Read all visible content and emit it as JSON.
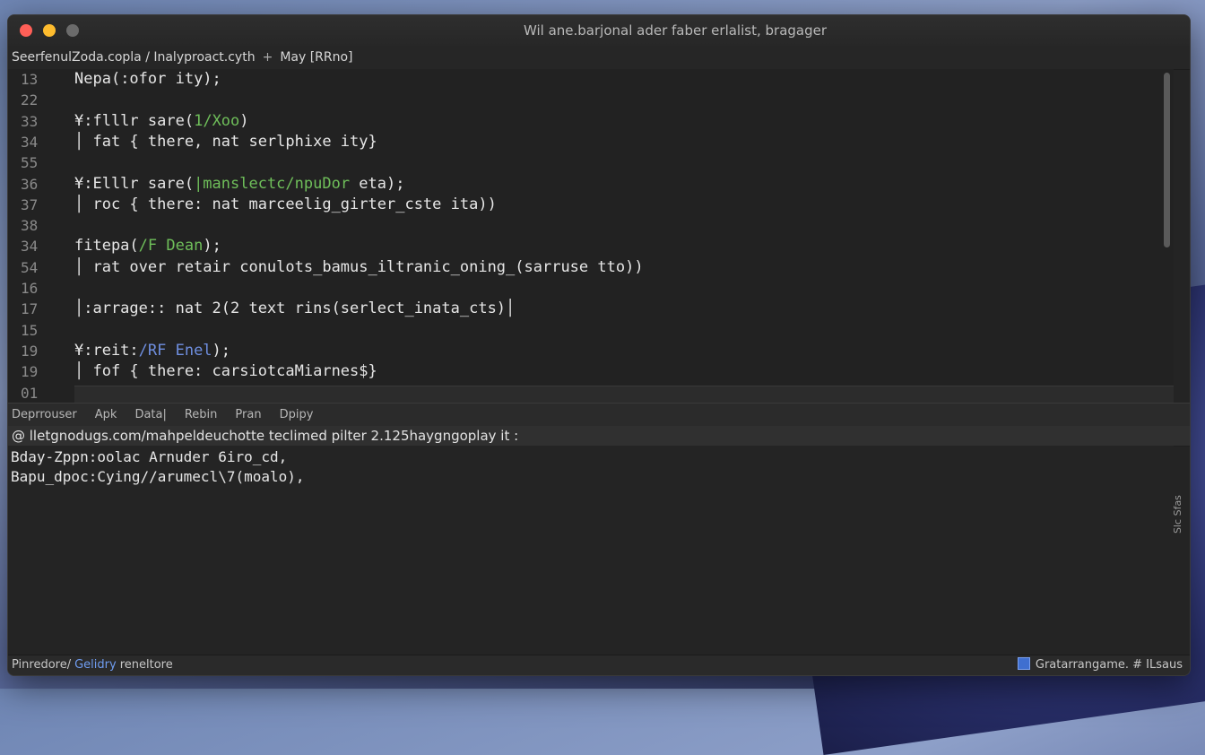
{
  "window": {
    "title": "Wil ane.barjonal ader faber erlalist, bragager"
  },
  "breadcrumb": {
    "path": "Seerfenul​Zoda.copla / Inalyproact.cyth",
    "separator": "+",
    "current": "May [RRno]"
  },
  "editor": {
    "lines": [
      {
        "num": "13",
        "parts": [
          {
            "t": "Nepa‏(:ofor ity);"
          }
        ]
      },
      {
        "num": "22",
        "parts": [
          {
            "t": ""
          }
        ]
      },
      {
        "num": "33",
        "parts": [
          {
            "t": "¥:flllr sare("
          },
          {
            "t": "‏/1Xoo‏",
            "c": "green"
          },
          {
            "t": ")"
          }
        ]
      },
      {
        "num": "34",
        "parts": [
          {
            "t": "│ fat { there, nat serlphixe ity}"
          }
        ]
      },
      {
        "num": "55",
        "parts": [
          {
            "t": ""
          }
        ]
      },
      {
        "num": "36",
        "parts": [
          {
            "t": "¥:Elllr sare("
          },
          {
            "t": "|manslectc/npuDor",
            "c": "green"
          },
          {
            "t": " eta);"
          }
        ]
      },
      {
        "num": "37",
        "parts": [
          {
            "t": "│ roc { there: nat marceelig_girter_cste ita))"
          }
        ]
      },
      {
        "num": "38",
        "parts": [
          {
            "t": ""
          }
        ]
      },
      {
        "num": "34",
        "parts": [
          {
            "t": "fitepa‏‏("
          },
          {
            "t": "/F Dean",
            "c": "green"
          },
          {
            "t": ");"
          }
        ]
      },
      {
        "num": "54",
        "parts": [
          {
            "t": "│ rat over retair conulots_bamus_iltranic_oning_(sarruse tto))"
          }
        ]
      },
      {
        "num": "16",
        "parts": [
          {
            "t": ""
          }
        ]
      },
      {
        "num": "17",
        "parts": [
          {
            "t": "│:arrage:: nat 2(2 text rins(serlect_inata_cts)│"
          }
        ]
      },
      {
        "num": "15",
        "parts": [
          {
            "t": ""
          }
        ]
      },
      {
        "num": "19",
        "parts": [
          {
            "t": "¥:reit:"
          },
          {
            "t": "/RF Enel",
            "c": "blue"
          },
          {
            "t": ");"
          }
        ]
      },
      {
        "num": "19",
        "parts": [
          {
            "t": "│ fof { there: carsiotcaMiarnes$}"
          }
        ]
      },
      {
        "num": "01",
        "parts": [
          {
            "t": ""
          }
        ]
      }
    ]
  },
  "panel": {
    "tabs": [
      "Deprrouser",
      "Apk",
      "Data|",
      "Rebin",
      "Pran",
      "Dpipy"
    ]
  },
  "url_bar": {
    "text": "@ lletgnodugs.com/mahpeldeuchotte teclimed pilter 2.125haygngoplay it :"
  },
  "terminal": {
    "lines": [
      "Bday-Zppn:oolac Arnuder 6iro_cd‏,",
      "Bapu_dpoc:Cying//arumecl\\7(moalo)‏,"
    ],
    "side_label": "Slc Sfas"
  },
  "statusbar": {
    "left_text": "Pinredore/",
    "badge": "Gelidry",
    "after_badge": "reneltore",
    "right_text": "Gratarrangame. # ILsaus"
  }
}
